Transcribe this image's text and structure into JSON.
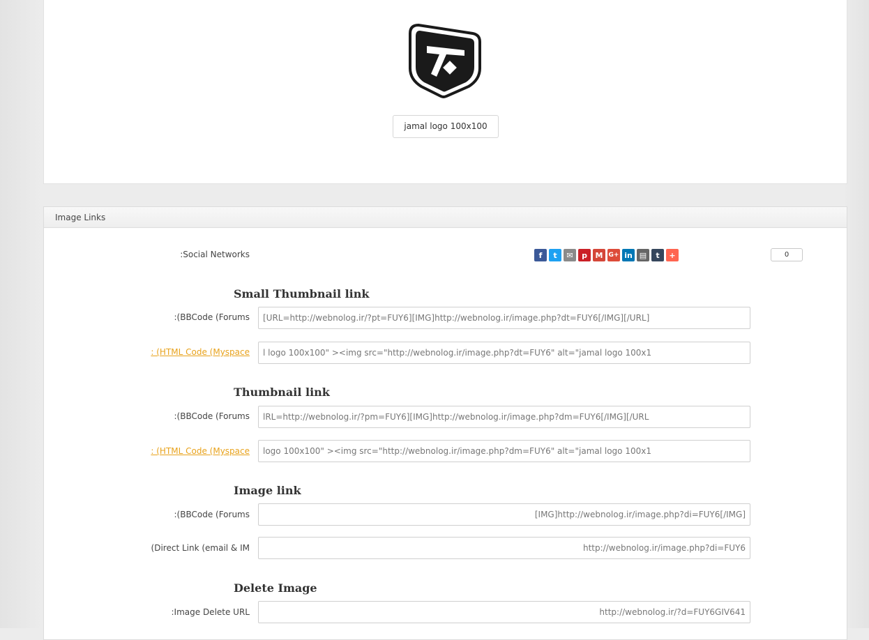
{
  "image": {
    "caption": "jamal logo 100x100"
  },
  "links_panel": {
    "header": "Image Links",
    "social_label": ":Social Networks",
    "social_buttons": [
      {
        "icon": "facebook-icon",
        "glyph": "f",
        "color": "#3b5998"
      },
      {
        "icon": "twitter-icon",
        "glyph": "t",
        "color": "#1da1f2"
      },
      {
        "icon": "email-icon",
        "glyph": "✉",
        "color": "#8a8a8a"
      },
      {
        "icon": "pinterest-icon",
        "glyph": "p",
        "color": "#cb2027"
      },
      {
        "icon": "gmail-icon",
        "glyph": "M",
        "color": "#d44638"
      },
      {
        "icon": "google-plus-icon",
        "glyph": "G+",
        "color": "#dd4b39"
      },
      {
        "icon": "linkedin-icon",
        "glyph": "in",
        "color": "#0077b5"
      },
      {
        "icon": "print-icon",
        "glyph": "▤",
        "color": "#666666"
      },
      {
        "icon": "tumblr-icon",
        "glyph": "t",
        "color": "#35465c"
      },
      {
        "icon": "share-more-icon",
        "glyph": "+",
        "color": "#ff6550"
      }
    ],
    "share_count": "0",
    "sections": {
      "small_thumb": {
        "title": "Small Thumbnail link",
        "bbcode_label": ":(BBCode (Forums",
        "bbcode_value": "[URL=http://webnolog.ir/?pt=FUY6][IMG]http://webnolog.ir/image.php?dt=FUY6[/IMG][/URL]",
        "html_label": ": (HTML Code (Myspace",
        "html_value": "l logo 100x100\" ><img src=\"http://webnolog.ir/image.php?dt=FUY6\" alt=\"jamal logo 100x1"
      },
      "thumb": {
        "title": "Thumbnail link",
        "bbcode_label": ":(BBCode (Forums",
        "bbcode_value": "lRL=http://webnolog.ir/?pm=FUY6][IMG]http://webnolog.ir/image.php?dm=FUY6[/IMG][/URL",
        "html_label": ": (HTML Code (Myspace",
        "html_value": "logo 100x100\" ><img src=\"http://webnolog.ir/image.php?dm=FUY6\" alt=\"jamal logo 100x1"
      },
      "image": {
        "title": "Image link",
        "bbcode_label": ":(BBCode (Forums",
        "bbcode_value": "[IMG]http://webnolog.ir/image.php?di=FUY6[/IMG]",
        "direct_label": "(Direct Link (email & IM",
        "direct_value": "http://webnolog.ir/image.php?di=FUY6"
      },
      "delete": {
        "title": "Delete Image",
        "delete_label": ":Image Delete URL",
        "delete_value": "http://webnolog.ir/?d=FUY6GIV641"
      }
    }
  }
}
